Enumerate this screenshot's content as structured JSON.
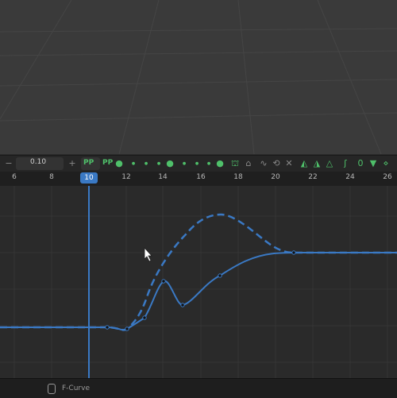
{
  "toolbar": {
    "value": "0.10",
    "pp_dropdown_label": "PP",
    "pp_label": "PP",
    "accent_color": "#4fc06a"
  },
  "timeline": {
    "ticks": [
      "6",
      "8",
      "10",
      "12",
      "14",
      "16",
      "18",
      "20",
      "22",
      "24",
      "26"
    ],
    "current_frame": "10",
    "accent_color": "#3a79c4"
  },
  "status": {
    "label": "F-Curve",
    "icon": "mouse-icon"
  }
}
